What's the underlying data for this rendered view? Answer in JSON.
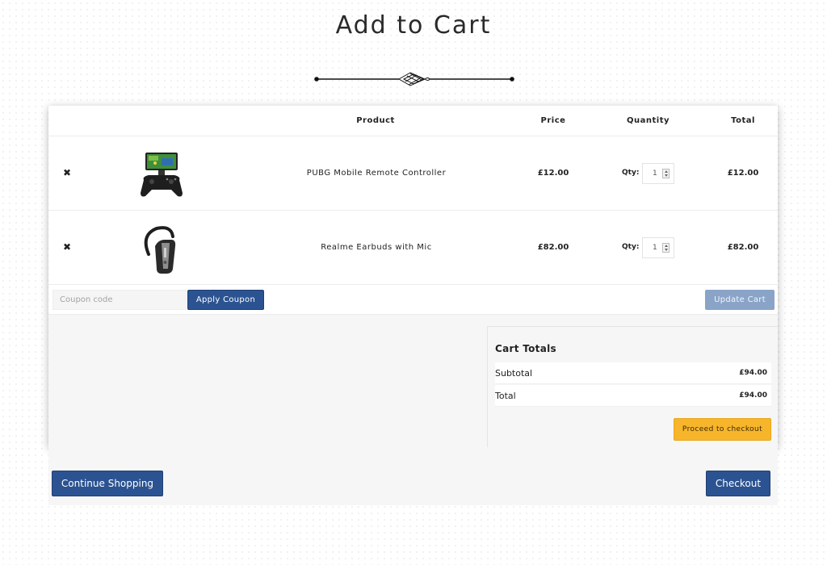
{
  "page": {
    "title": "Add to Cart"
  },
  "table": {
    "headers": {
      "product": "Product",
      "price": "Price",
      "quantity": "Quantity",
      "total": "Total"
    },
    "remove_glyph": "✖",
    "qty_label": "Qty:",
    "rows": [
      {
        "name": "PUBG Mobile Remote Controller",
        "price": "£12.00",
        "qty": "1",
        "total": "£12.00",
        "image_icon": "game-controller-icon"
      },
      {
        "name": "Realme Earbuds with Mic",
        "price": "£82.00",
        "qty": "1",
        "total": "£82.00",
        "image_icon": "bluetooth-earpiece-icon"
      }
    ]
  },
  "coupon": {
    "placeholder": "Coupon code",
    "apply_label": "Apply Coupon"
  },
  "update_label": "Update Cart",
  "totals": {
    "title": "Cart Totals",
    "subtotal_label": "Subtotal",
    "subtotal": "£94.00",
    "total_label": "Total",
    "total": "£94.00",
    "proceed_label": "Proceed to checkout"
  },
  "footer": {
    "continue_label": "Continue Shopping",
    "checkout_label": "Checkout"
  },
  "colors": {
    "primary": "#2c5391",
    "update_disabled": "#8aa4c8",
    "proceed": "#f7b52c"
  }
}
